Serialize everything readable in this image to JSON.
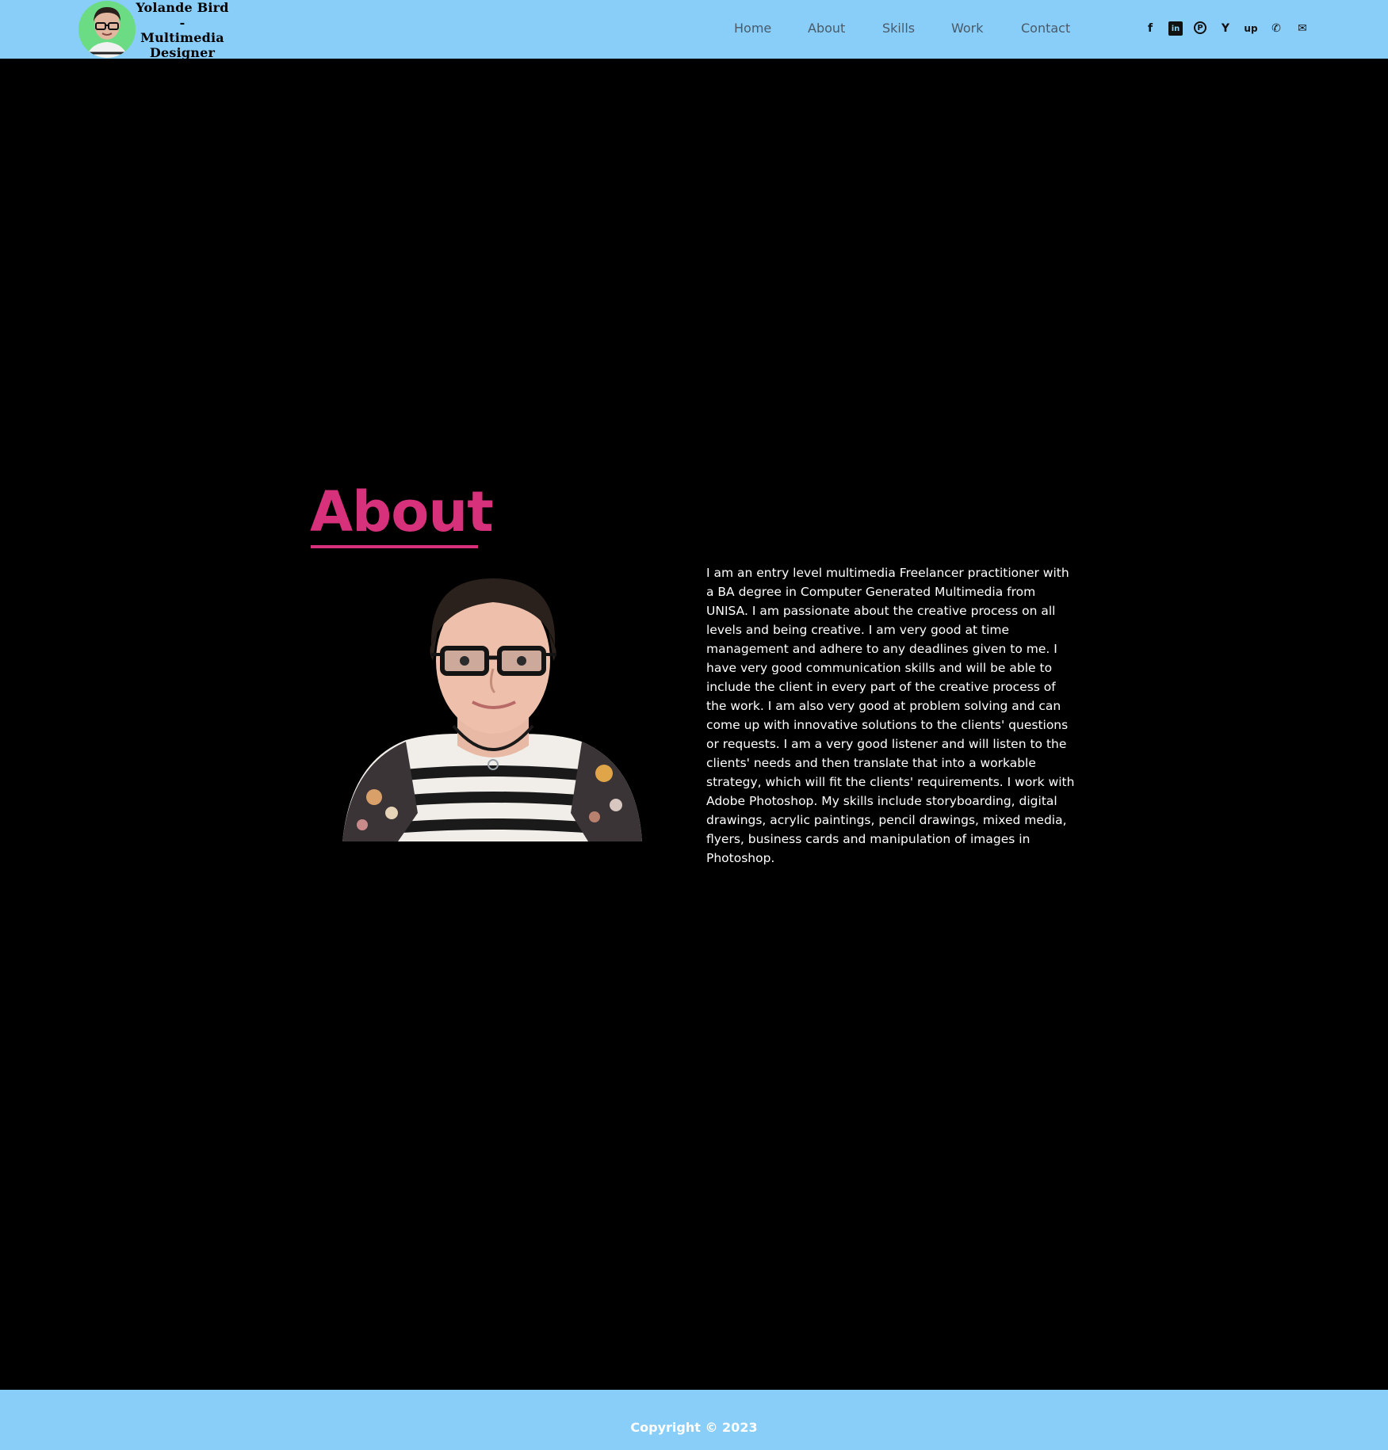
{
  "header": {
    "logo_lines": [
      "Yolande Bird",
      "-",
      "Multimedia",
      "Designer"
    ],
    "nav": [
      {
        "label": "Home"
      },
      {
        "label": "About"
      },
      {
        "label": "Skills"
      },
      {
        "label": "Work"
      },
      {
        "label": "Contact"
      }
    ],
    "social_icons": [
      "facebook-icon",
      "linkedin-icon",
      "pinterest-icon",
      "fiverr-icon",
      "upwork-icon",
      "phone-icon",
      "mail-icon"
    ],
    "social_glyphs": [
      "f",
      "in",
      "P",
      "Y",
      "up",
      "✆",
      "✉"
    ]
  },
  "about": {
    "heading": "About",
    "bio": "I am an entry level multimedia Freelancer practitioner with a BA degree in Computer Generated Multimedia from UNISA. I am passionate about the creative process on all levels and being creative. I am very good at time management and adhere to any deadlines given to me. I have very good communication skills and will be able to include the client in every part of the creative process of the work. I am also very good at problem solving and can come up with innovative solutions to the clients' questions or requests. I am a very good listener and will listen to the clients' needs and then translate that into a workable strategy, which will fit the clients' requirements. I work with Adobe Photoshop. My skills include storyboarding, digital drawings, acrylic paintings, pencil drawings, mixed media, flyers, business cards and manipulation of images in Photoshop."
  },
  "footer": {
    "copyright": "Copyright © 2023"
  },
  "colors": {
    "header_bg": "#89cdf9",
    "accent": "#d6317a",
    "page_bg": "#000000",
    "logo_avatar_bg": "#6bdc84"
  }
}
